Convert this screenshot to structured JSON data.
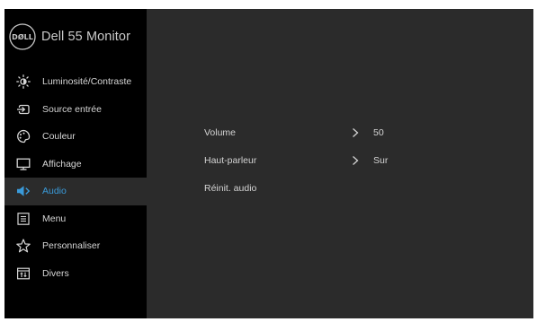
{
  "header": {
    "logo_text": "DELL",
    "product_name": "Dell 55 Monitor"
  },
  "menu": {
    "items": [
      {
        "label": "Luminosité/Contraste",
        "icon": "brightness-icon"
      },
      {
        "label": "Source entrée",
        "icon": "input-source-icon"
      },
      {
        "label": "Couleur",
        "icon": "color-palette-icon"
      },
      {
        "label": "Affichage",
        "icon": "display-icon"
      },
      {
        "label": "Audio",
        "icon": "speaker-icon",
        "active": true
      },
      {
        "label": "Menu",
        "icon": "menu-list-icon"
      },
      {
        "label": "Personnaliser",
        "icon": "star-icon"
      },
      {
        "label": "Divers",
        "icon": "others-icon"
      }
    ]
  },
  "audio": {
    "volume": {
      "label": "Volume",
      "value": "50"
    },
    "speaker": {
      "label": "Haut-parleur",
      "value": "Sur"
    },
    "reset": {
      "label": "Réinit. audio"
    }
  },
  "colors": {
    "active_accent": "#3a9ad9",
    "sidebar_bg": "#000000",
    "panel_bg": "#2b2b2b"
  }
}
